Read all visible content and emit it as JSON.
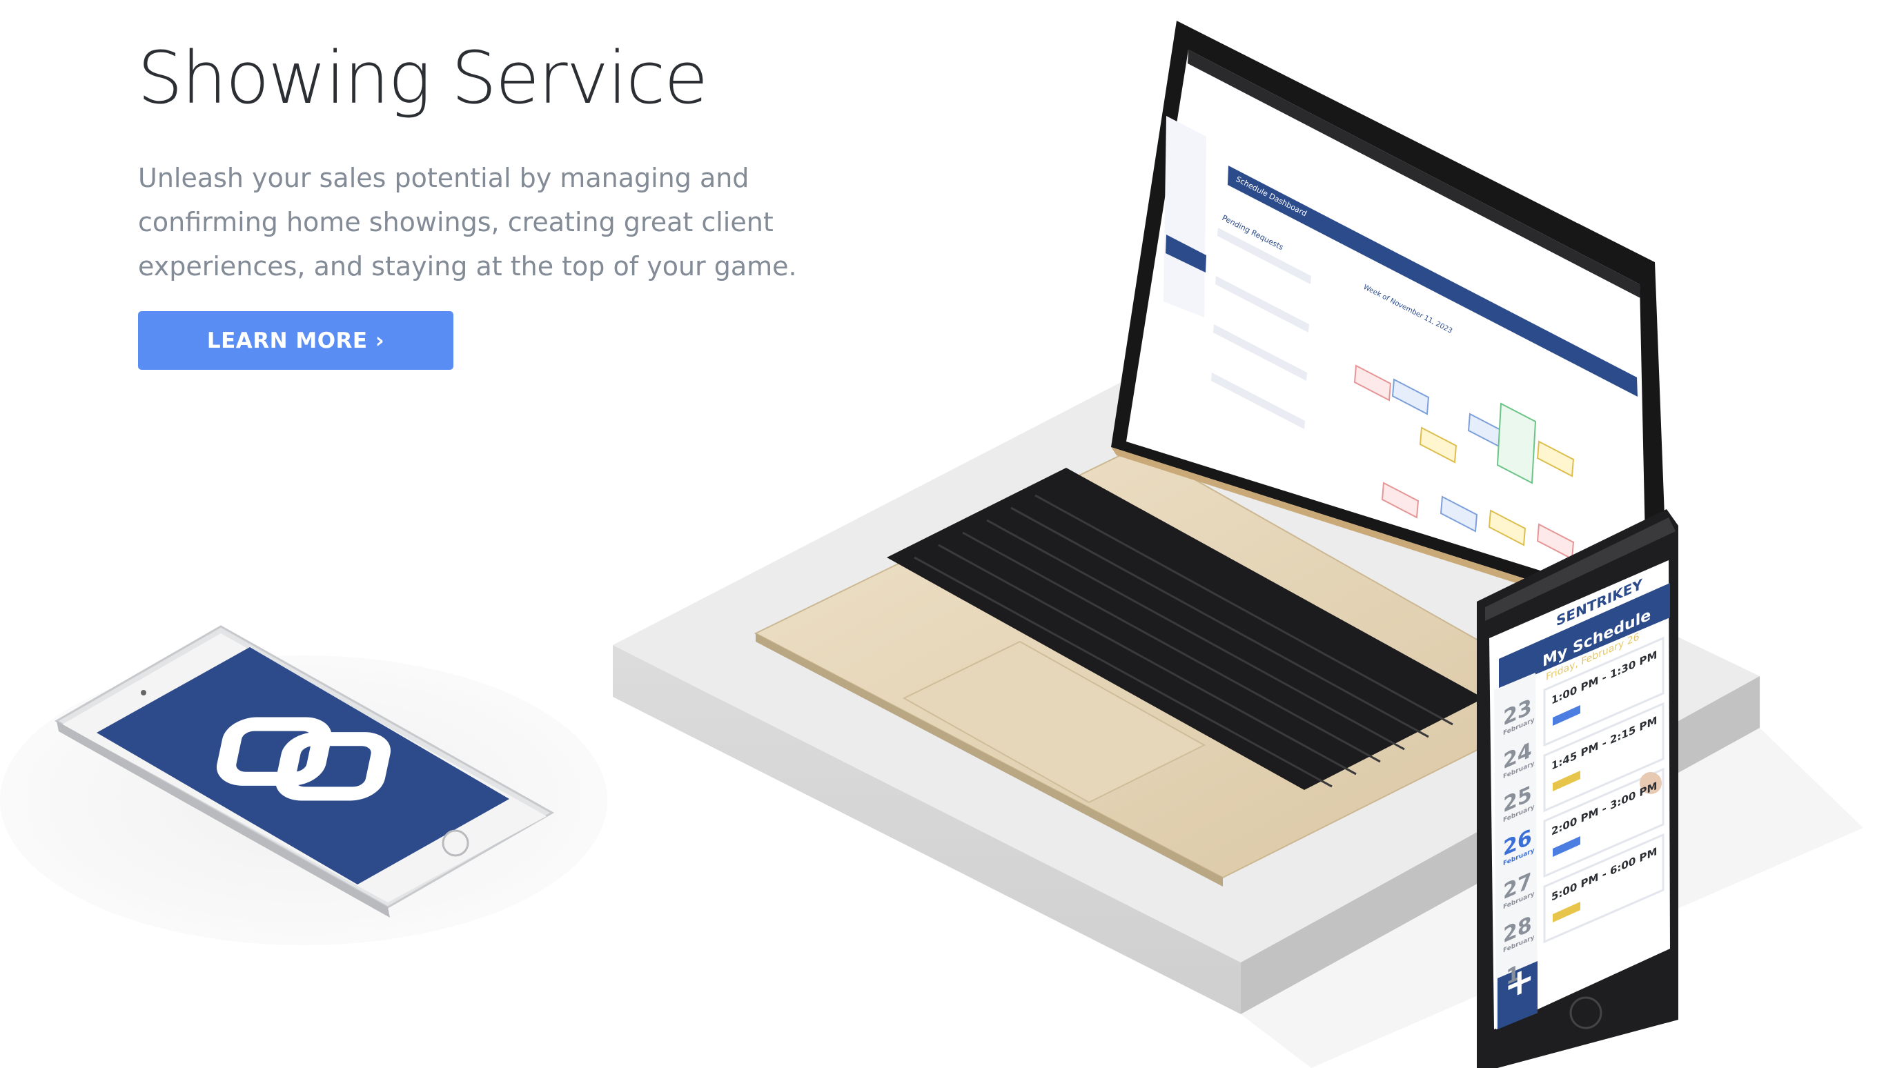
{
  "hero": {
    "title": "Showing Service",
    "description": "Unleash your sales potential by managing and confirming home showings, creating great client experiences, and staying at the top of your game.",
    "cta_label": "LEARN MORE ›"
  },
  "laptop_screen": {
    "dashboard_title": "Schedule Dashboard",
    "pending_label": "Pending Requests",
    "week_label": "Week of November 11, 2023"
  },
  "phone_app": {
    "brand": "SENTRIKEY",
    "screen_title": "My Schedule",
    "date_label": "Friday, February 26",
    "days": [
      {
        "num": "23",
        "month": "February"
      },
      {
        "num": "24",
        "month": "February"
      },
      {
        "num": "25",
        "month": "February"
      },
      {
        "num": "26",
        "month": "February"
      },
      {
        "num": "27",
        "month": "February"
      },
      {
        "num": "28",
        "month": "February"
      },
      {
        "num": "1",
        "month": ""
      }
    ],
    "appointments": [
      {
        "time": "1:00 PM - 1:30 PM"
      },
      {
        "time": "1:45 PM - 2:15 PM"
      },
      {
        "time": "2:00 PM - 3:00 PM"
      },
      {
        "time": "5:00 PM - 6:00 PM"
      }
    ],
    "add_symbol": "+"
  },
  "colors": {
    "accent": "#5a8df3",
    "brand_navy": "#2c4b8b",
    "title": "#2b2e33",
    "body": "#838b96"
  }
}
